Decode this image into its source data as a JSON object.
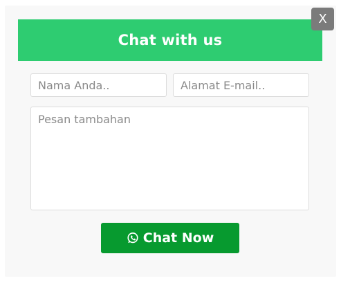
{
  "close": {
    "label": "X"
  },
  "header": {
    "title": "Chat with us"
  },
  "form": {
    "name_placeholder": "Nama Anda..",
    "email_placeholder": "Alamat E-mail..",
    "message_placeholder": "Pesan tambahan"
  },
  "submit": {
    "label": "Chat Now",
    "icon": "whatsapp-icon"
  },
  "colors": {
    "header_bg": "#2ecc71",
    "button_bg": "#079a2f",
    "close_bg": "#7b7b7b",
    "popup_bg": "#f8f8f8"
  }
}
